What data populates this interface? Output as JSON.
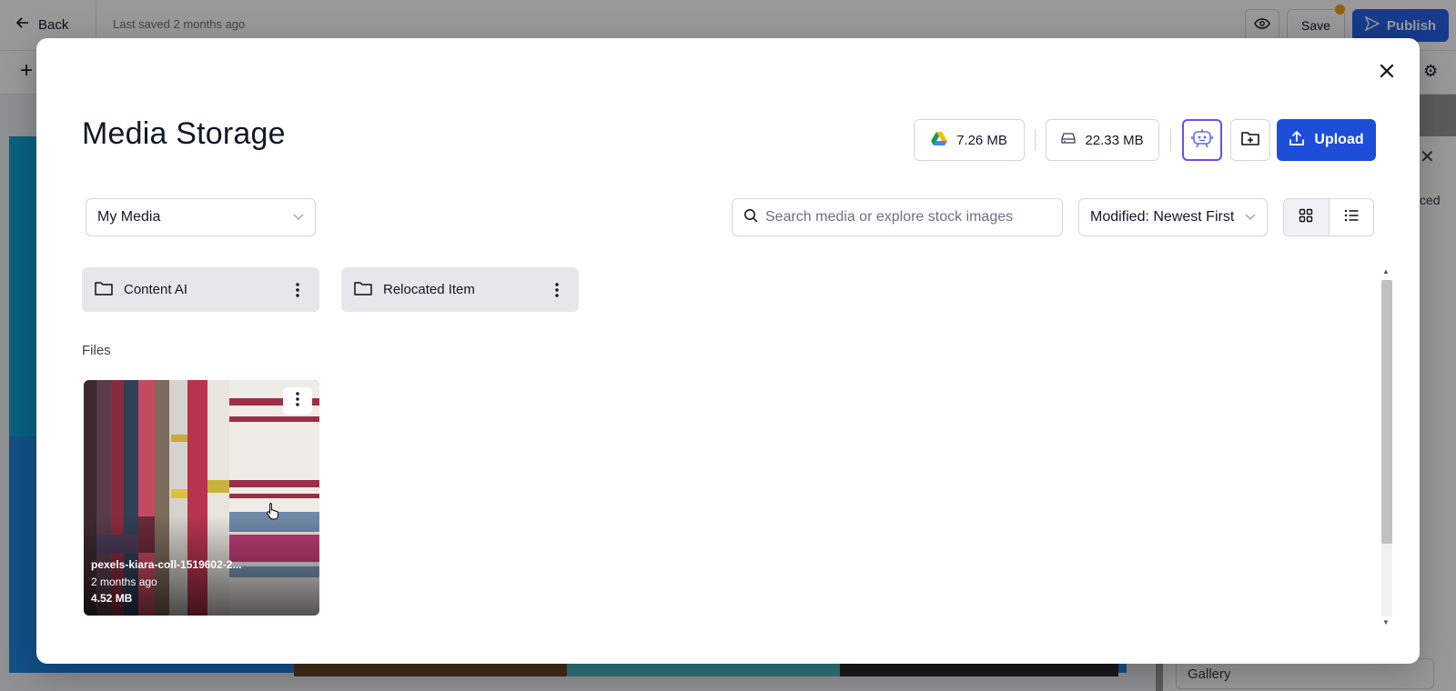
{
  "background": {
    "back_label": "Back",
    "last_saved": "Last saved 2 months ago",
    "save_label": "Save",
    "publish_label": "Publish",
    "panel_partial_text": "ced",
    "gallery_label": "Gallery"
  },
  "modal": {
    "title": "Media Storage",
    "storage": {
      "drive_size": "7.26 MB",
      "drive_icon": "google-drive-icon",
      "disk_size": "22.33 MB",
      "disk_icon": "hard-drive-icon"
    },
    "actions": {
      "ai_icon": "robot-assistant-icon",
      "new_folder_icon": "folder-plus-icon",
      "upload_label": "Upload"
    },
    "filters": {
      "source_select_value": "My Media",
      "search_placeholder": "Search media or explore stock images",
      "search_value": "",
      "sort_value": "Modified: Newest First",
      "view_mode": "grid"
    },
    "folders": [
      {
        "name": "Content AI"
      },
      {
        "name": "Relocated Item"
      }
    ],
    "files_label": "Files",
    "files": [
      {
        "name": "pexels-kiara-coll-1519602-2...",
        "modified": "2 months ago",
        "size": "4.52 MB"
      }
    ]
  },
  "colors": {
    "primary": "#1d4ed8",
    "ai_border": "#6d4cf0",
    "folder_bg": "#e5e7eb"
  }
}
